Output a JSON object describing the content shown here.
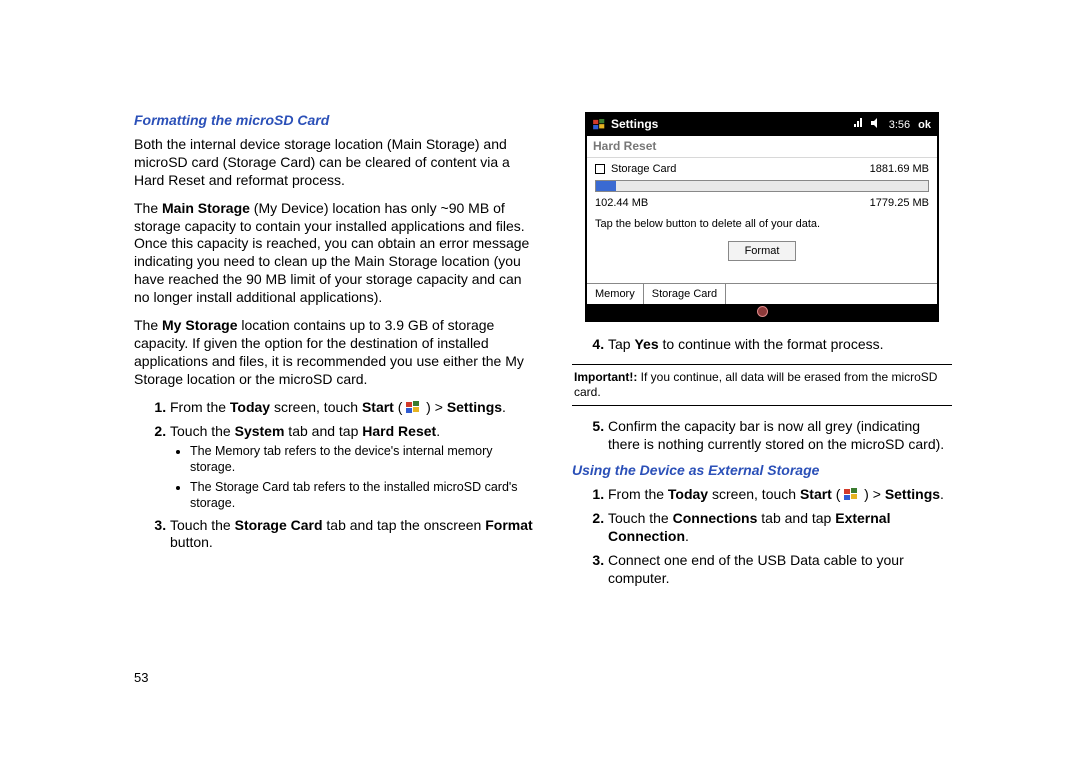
{
  "sections": {
    "format_heading": "Formatting the microSD Card",
    "use_ext_heading": "Using the Device as External Storage"
  },
  "left": {
    "p1": "Both the internal device storage location (Main Storage) and microSD card (Storage Card) can be cleared of content via a Hard Reset and reformat process.",
    "p2a": "The ",
    "p2b": "Main Storage",
    "p2c": " (My Device) location has only ~90 MB of storage capacity to contain your installed applications and files. Once this capacity is reached, you can obtain an error message indicating you need to clean up the Main Storage location (you have reached the 90 MB limit of your storage capacity and can no longer install additional applications).",
    "p3a": "The ",
    "p3b": "My Storage",
    "p3c": " location contains up to 3.9 GB of storage capacity. If given the option for the destination of installed applications and files, it is recommended you use either the My Storage location or the microSD card.",
    "s1_a": "From the ",
    "s1_b": "Today",
    "s1_c": " screen, touch ",
    "s1_d": "Start",
    "s1_e": " ( ",
    "s1_f": " ) > ",
    "s1_g": "Settings",
    "s1_h": ".",
    "s2_a": "Touch the ",
    "s2_b": "System",
    "s2_c": " tab and tap ",
    "s2_d": "Hard Reset",
    "s2_e": ".",
    "b1": "The Memory tab refers to the device's internal memory storage.",
    "b2": "The Storage Card tab refers to the installed microSD card's storage.",
    "s3_a": "Touch the ",
    "s3_b": "Storage Card",
    "s3_c": " tab and tap the onscreen ",
    "s3_d": "Format",
    "s3_e": " button."
  },
  "device": {
    "title": "Settings",
    "time": "3:56",
    "ok": "ok",
    "hardreset": "Hard Reset",
    "storagecard_label": "Storage Card",
    "total_mb": "1881.69 MB",
    "used_mb": "102.44 MB",
    "free_mb": "1779.25 MB",
    "msg": "Tap the below button to delete all of your data.",
    "format_btn": "Format",
    "tab_memory": "Memory",
    "tab_storage": "Storage Card"
  },
  "right": {
    "s4_a": "Tap ",
    "s4_b": "Yes",
    "s4_c": " to continue with the format process.",
    "important_label": "Important!:",
    "important_text": " If you continue, all data will be erased from the microSD card.",
    "s5": "Confirm the capacity bar is now all grey (indicating there is nothing currently stored on the microSD card).",
    "e1_a": "From the ",
    "e1_e": " ( ",
    "e1_f": " ) > ",
    "e2_a": "Touch the ",
    "e2_b": "Connections",
    "e2_c": " tab and tap ",
    "e2_d": "External Connection",
    "e2_e": ".",
    "e3": "Connect one end of the USB Data cable to your computer."
  },
  "page_number": "53"
}
